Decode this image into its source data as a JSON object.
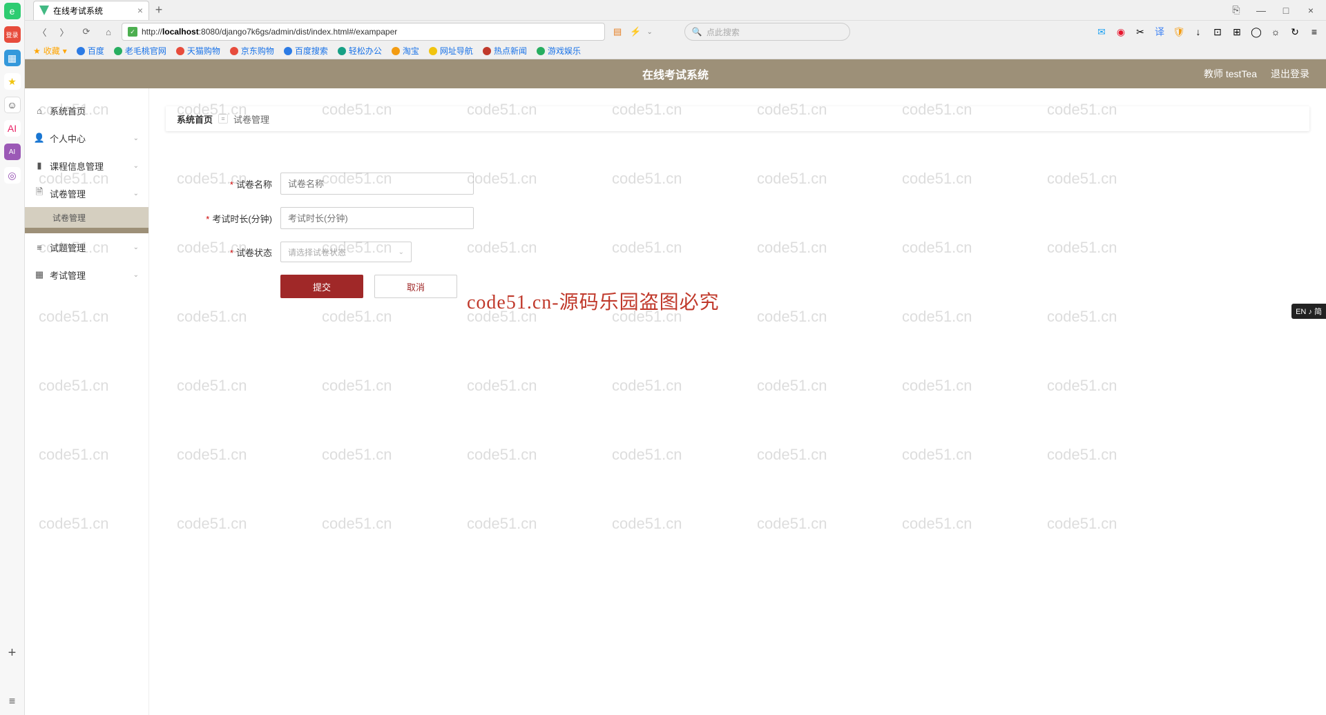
{
  "browser": {
    "tab_title": "在线考试系统",
    "url_prefix": "http://",
    "url_host": "localhost",
    "url_rest": ":8080/django7k6gs/admin/dist/index.html#/exampaper",
    "search_placeholder": "点此搜索"
  },
  "bookmarks": {
    "fav_label": "收藏",
    "items": [
      "百度",
      "老毛桃官网",
      "天猫购物",
      "京东购物",
      "百度搜索",
      "轻松办公",
      "淘宝",
      "网址导航",
      "热点新闻",
      "游戏娱乐"
    ]
  },
  "header": {
    "title": "在线考试系统",
    "user": "教师 testTea",
    "logout": "退出登录"
  },
  "sidebar": {
    "items": [
      {
        "icon": "home",
        "label": "系统首页",
        "expandable": false
      },
      {
        "icon": "user",
        "label": "个人中心",
        "expandable": true
      },
      {
        "icon": "book",
        "label": "课程信息管理",
        "expandable": true
      },
      {
        "icon": "paper",
        "label": "试卷管理",
        "expandable": true
      },
      {
        "icon": "sub",
        "label": "试卷管理",
        "expandable": false,
        "sub": true
      },
      {
        "icon": "list",
        "label": "试题管理",
        "expandable": true
      },
      {
        "icon": "grid",
        "label": "考试管理",
        "expandable": true
      }
    ]
  },
  "breadcrumb": {
    "root": "系统首页",
    "current": "试卷管理"
  },
  "form": {
    "name_label": "试卷名称",
    "name_placeholder": "试卷名称",
    "duration_label": "考试时长(分钟)",
    "duration_placeholder": "考试时长(分钟)",
    "status_label": "试卷状态",
    "status_placeholder": "请选择试卷状态",
    "submit": "提交",
    "cancel": "取消"
  },
  "watermark_center": "code51.cn-源码乐园盗图必究",
  "watermark_text": "code51.cn",
  "ime": "EN ♪ 简"
}
